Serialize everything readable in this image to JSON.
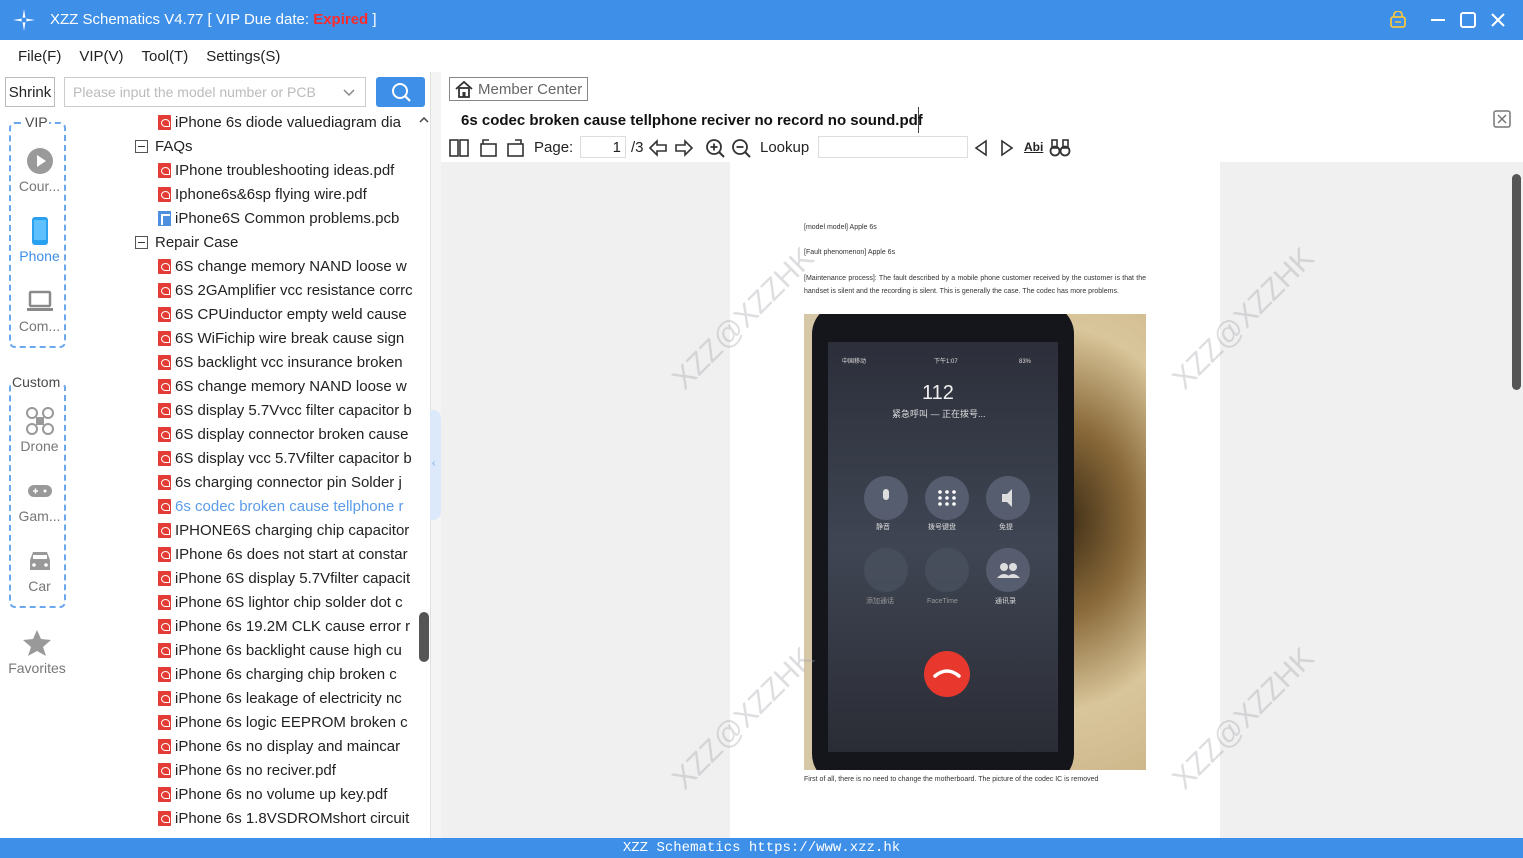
{
  "titlebar": {
    "title_prefix": "XZZ Schematics V4.77 [ VIP Due date: ",
    "expired": "Expired",
    "title_suffix": " ]"
  },
  "menu": [
    "File(F)",
    "VIP(V)",
    "Tool(T)",
    "Settings(S)"
  ],
  "search": {
    "shrink_label": "Shrink",
    "placeholder": "Please input the model number or PCB"
  },
  "categories": {
    "vip_label": "VIP",
    "custom_label": "Custom",
    "vip_items": [
      {
        "label": "Cour...",
        "icon": "play-circle-icon"
      },
      {
        "label": "Phone",
        "icon": "phone-icon"
      },
      {
        "label": "Com...",
        "icon": "laptop-icon"
      }
    ],
    "custom_items": [
      {
        "label": "Drone",
        "icon": "drone-icon"
      },
      {
        "label": "Gam...",
        "icon": "gamepad-icon"
      },
      {
        "label": "Car",
        "icon": "car-icon"
      }
    ],
    "favorites": "Favorites"
  },
  "tree": [
    {
      "type": "pdf",
      "indent": 1,
      "label": "iPhone 6s diode valuediagram dia"
    },
    {
      "type": "folder",
      "indent": 0,
      "label": "FAQs"
    },
    {
      "type": "pdf",
      "indent": 1,
      "label": "IPhone troubleshooting ideas.pdf"
    },
    {
      "type": "pdf",
      "indent": 1,
      "label": "Iphone6s&6sp flying wire.pdf"
    },
    {
      "type": "pcb",
      "indent": 1,
      "label": "iPhone6S Common problems.pcb"
    },
    {
      "type": "folder",
      "indent": 0,
      "label": "Repair Case"
    },
    {
      "type": "pdf",
      "indent": 1,
      "label": "6S  change memory NAND loose w"
    },
    {
      "type": "pdf",
      "indent": 1,
      "label": "6S 2GAmplifier vcc resistance corrc"
    },
    {
      "type": "pdf",
      "indent": 1,
      "label": "6S CPUinductor empty weld cause"
    },
    {
      "type": "pdf",
      "indent": 1,
      "label": "6S WiFichip wire break  cause sign"
    },
    {
      "type": "pdf",
      "indent": 1,
      "label": "6S backlight vcc insurance broken"
    },
    {
      "type": "pdf",
      "indent": 1,
      "label": "6S change memory NAND loose w"
    },
    {
      "type": "pdf",
      "indent": 1,
      "label": "6S display 5.7Vvcc filter capacitor b"
    },
    {
      "type": "pdf",
      "indent": 1,
      "label": "6S display connector broken cause"
    },
    {
      "type": "pdf",
      "indent": 1,
      "label": "6S display vcc 5.7Vfilter capacitor b"
    },
    {
      "type": "pdf",
      "indent": 1,
      "label": "6s charging connector pin Solder j"
    },
    {
      "type": "pdf",
      "indent": 1,
      "label": "6s codec broken cause tellphone r",
      "active": true
    },
    {
      "type": "pdf",
      "indent": 1,
      "label": "IPHONE6S charging chip capacitor"
    },
    {
      "type": "pdf",
      "indent": 1,
      "label": "IPhone 6s does not start at constar"
    },
    {
      "type": "pdf",
      "indent": 1,
      "label": "iPhone 6S display 5.7Vfilter capacit"
    },
    {
      "type": "pdf",
      "indent": 1,
      "label": "iPhone 6S lightor chip solder dot c"
    },
    {
      "type": "pdf",
      "indent": 1,
      "label": "iPhone 6s  19.2M CLK cause error r"
    },
    {
      "type": "pdf",
      "indent": 1,
      "label": "iPhone 6s  backlight cause high cu"
    },
    {
      "type": "pdf",
      "indent": 1,
      "label": "iPhone 6s  charging chip broken c"
    },
    {
      "type": "pdf",
      "indent": 1,
      "label": "iPhone 6s  leakage of electricity nc"
    },
    {
      "type": "pdf",
      "indent": 1,
      "label": "iPhone 6s  logic EEPROM broken c"
    },
    {
      "type": "pdf",
      "indent": 1,
      "label": "iPhone 6s  no display and maincar"
    },
    {
      "type": "pdf",
      "indent": 1,
      "label": "iPhone 6s  no reciver.pdf"
    },
    {
      "type": "pdf",
      "indent": 1,
      "label": "iPhone 6s  no volume up key.pdf"
    },
    {
      "type": "pdf",
      "indent": 1,
      "label": "iPhone 6s 1.8VSDROMshort circuit"
    }
  ],
  "right": {
    "member_center": "Member Center",
    "doc_tab": "6s codec broken cause tellphone reciver no record no sound.pdf",
    "toolbar": {
      "page_label": "Page:",
      "page_value": "1",
      "page_total": "/3",
      "lookup_label": "Lookup",
      "abi": "Abi"
    }
  },
  "pdf_page": {
    "model": "[model model] Apple 6s",
    "fault": "[Fault phenomenon] Apple 6s",
    "process": "[Maintenance process]: The fault described by a mobile phone customer received by the customer is that the handset is silent and the recording is silent. This is generally the case. The codec has more problems.",
    "footer": "First of all, there is no need to change the motherboard. The picture of the codec IC is removed",
    "phone": {
      "carrier": "中国移动",
      "time": "下午1:07",
      "battery": "83%",
      "number": "112",
      "status": "紧急呼叫 — 正在拨号...",
      "buttons": [
        "静音",
        "拨号键盘",
        "免提",
        "添加通话",
        "FaceTime",
        "通讯录"
      ]
    },
    "watermark": "XZZ@XZZHK"
  },
  "statusbar": "XZZ Schematics https://www.xzz.hk",
  "colors": {
    "accent": "#3d8fe8",
    "expired": "#ff2a2a",
    "active_link": "#5b9be8",
    "pdf_red": "#e23c34"
  }
}
